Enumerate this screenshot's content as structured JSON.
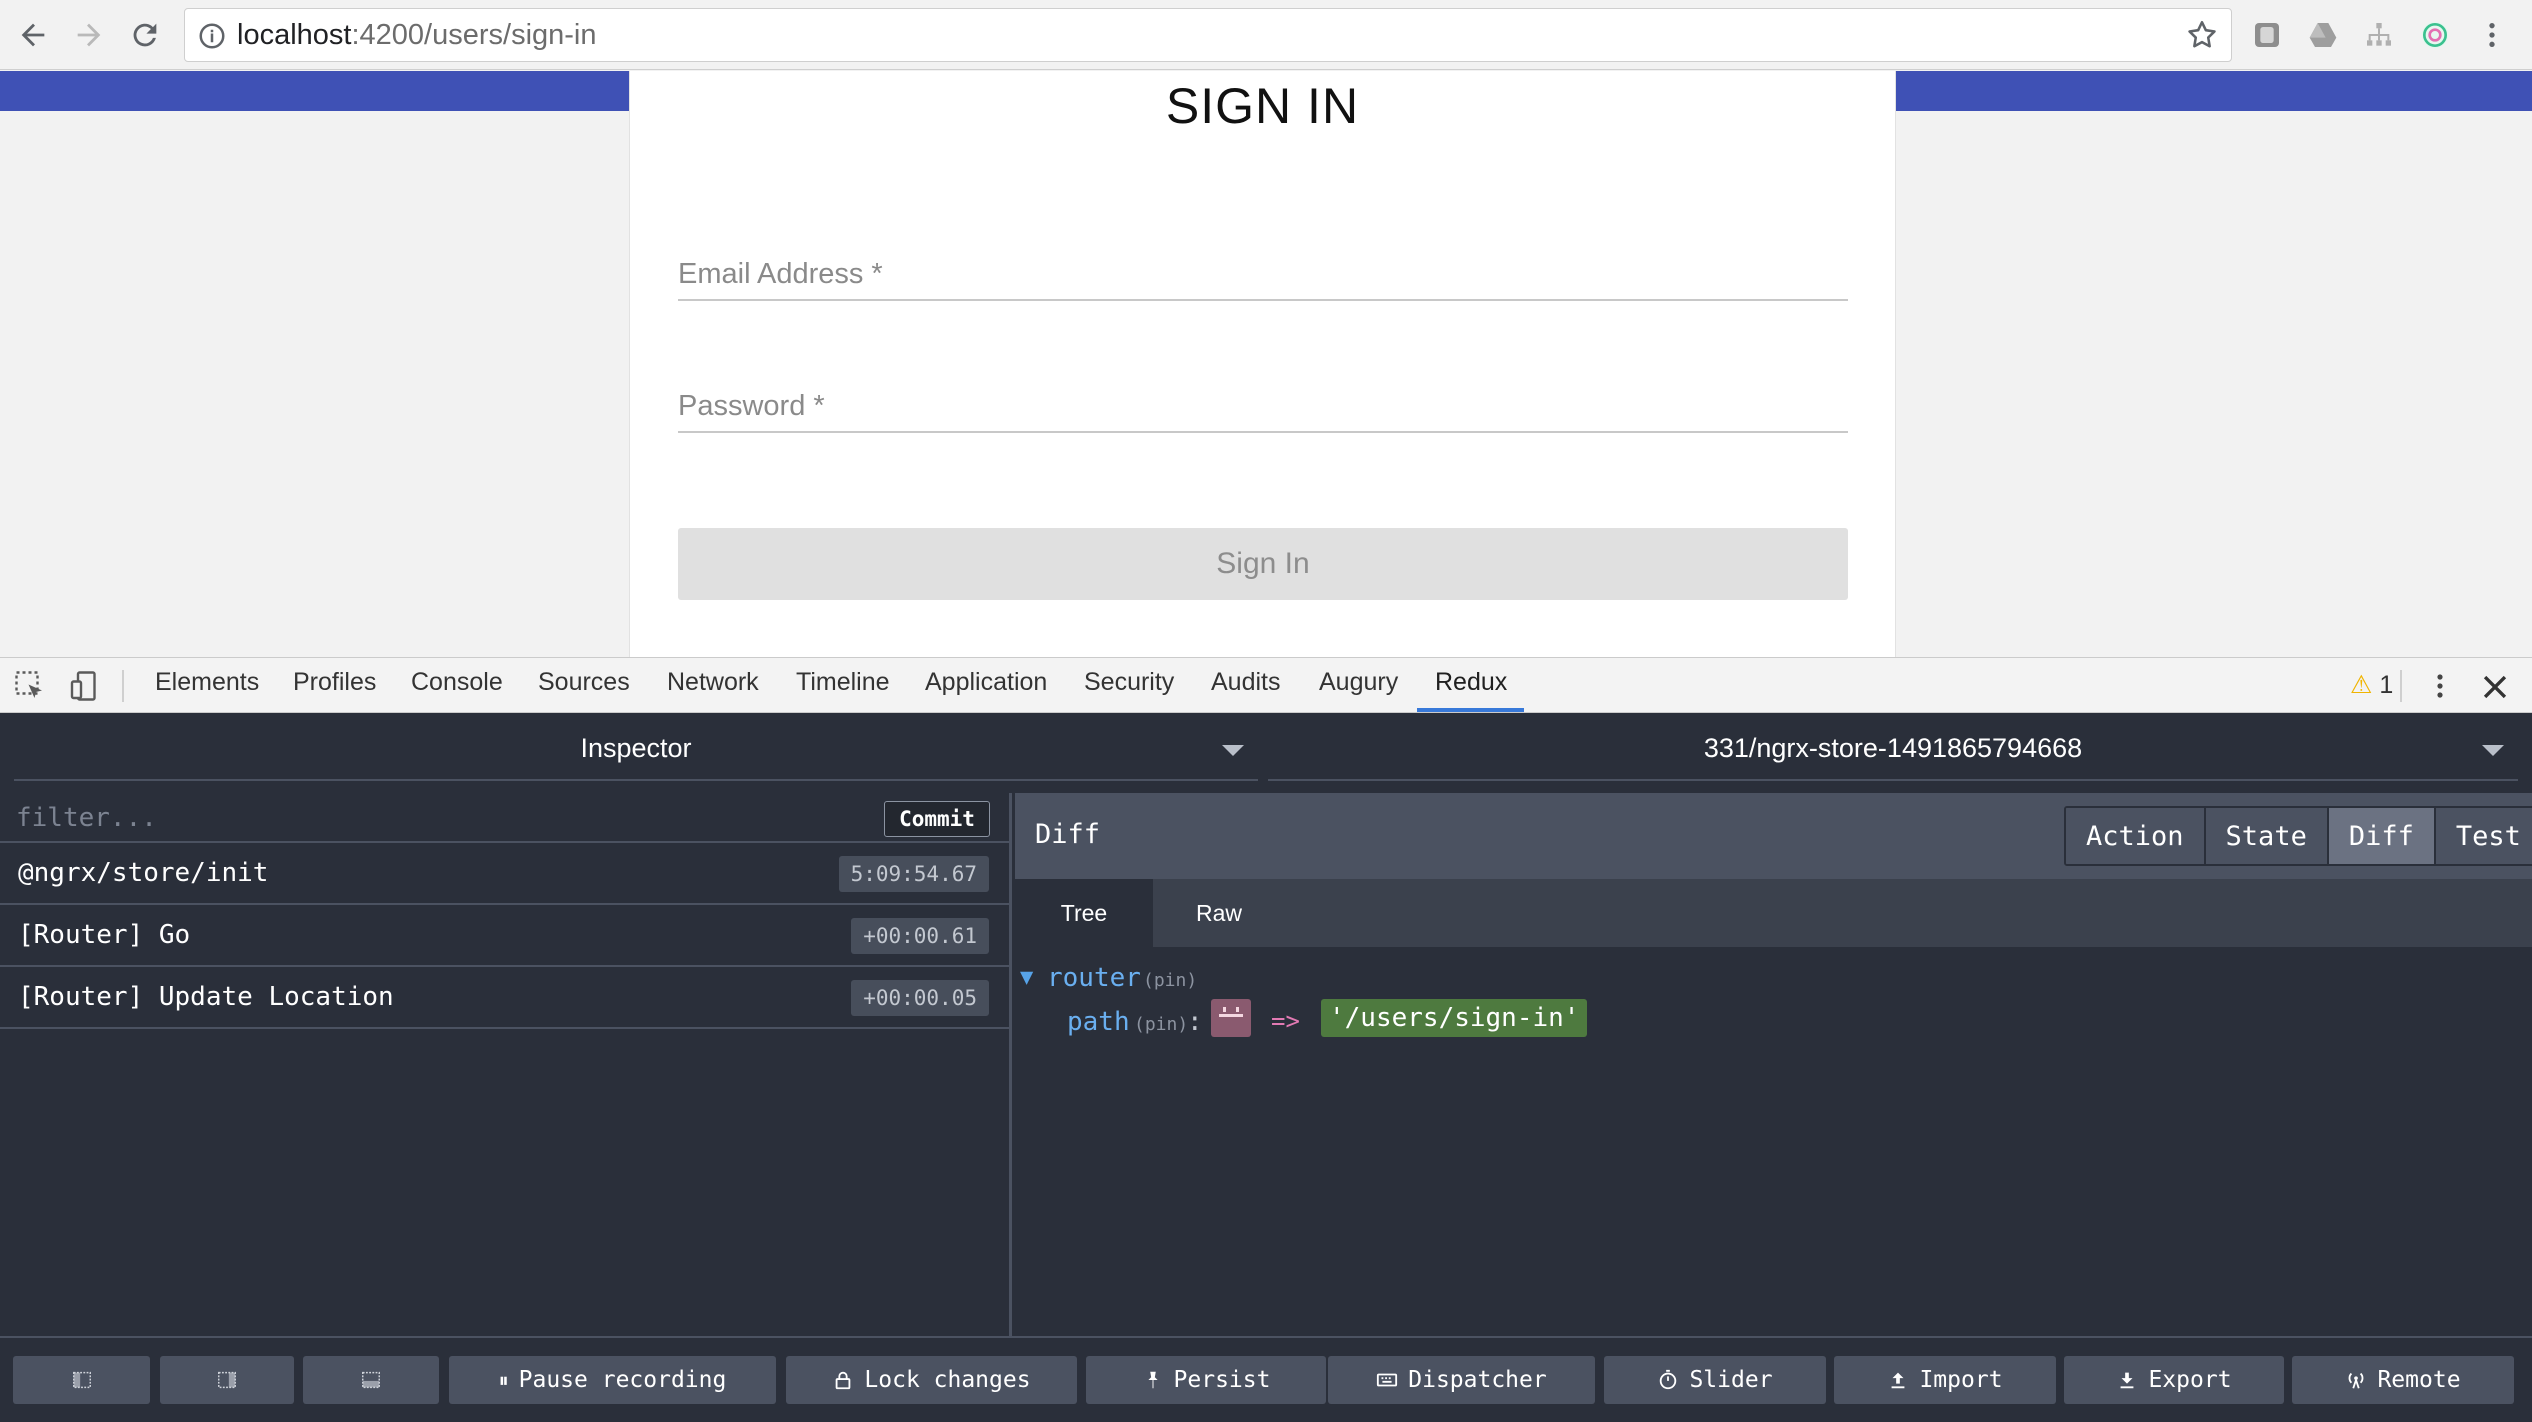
{
  "browser": {
    "url_host": "localhost",
    "url_path": ":4200/users/sign-in"
  },
  "page": {
    "title": "SIGN IN",
    "email_label": "Email Address *",
    "password_label": "Password *",
    "signin_button": "Sign In",
    "accent_color": "#3f51b5"
  },
  "devtools": {
    "tabs": [
      "Elements",
      "Profiles",
      "Console",
      "Sources",
      "Network",
      "Timeline",
      "Application",
      "Security",
      "Audits",
      "Augury",
      "Redux"
    ],
    "active_tab": "Redux",
    "warning_count": "1"
  },
  "redux": {
    "monitor_select": "Inspector",
    "store_select": "331/ngrx-store-1491865794668",
    "filter_placeholder": "filter...",
    "commit_label": "Commit",
    "actions": [
      {
        "name": "@ngrx/store/init",
        "time": "5:09:54.67"
      },
      {
        "name": "[Router] Go",
        "time": "+00:00.61"
      },
      {
        "name": "[Router] Update Location",
        "time": "+00:00.05"
      }
    ],
    "panel_title": "Diff",
    "mode_tabs": [
      "Action",
      "State",
      "Diff",
      "Test"
    ],
    "active_mode": "Diff",
    "subtabs": [
      "Tree",
      "Raw"
    ],
    "active_subtab": "Tree",
    "tree": {
      "root_key": "router",
      "pin_label": "(pin)",
      "child_key": "path",
      "colon": ":",
      "arrow": "=>",
      "new_value": "'/users/sign-in'"
    },
    "toolbar": {
      "pause": "Pause recording",
      "lock": "Lock changes",
      "persist": "Persist",
      "dispatcher": "Dispatcher",
      "slider": "Slider",
      "import": "Import",
      "export": "Export",
      "remote": "Remote"
    }
  }
}
